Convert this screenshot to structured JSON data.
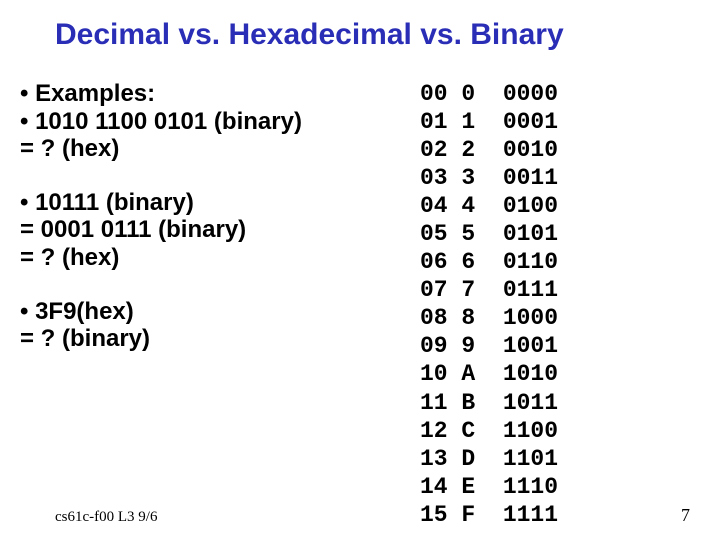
{
  "title": "Decimal vs. Hexadecimal vs. Binary",
  "examples_heading": "• Examples:",
  "ex1_line1": "• 1010 1100 0101 (binary)",
  "ex1_line2": "= ? (hex)",
  "ex2_line1": "• 10111 (binary)",
  "ex2_line2": "= 0001 0111 (binary)",
  "ex2_line3": "= ? (hex)",
  "ex3_line1": "• 3F9(hex)",
  "ex3_line2": "= ? (binary)",
  "footer_left": "cs61c-f00 L3 9/6",
  "footer_right": "7",
  "chart_data": {
    "type": "table",
    "title": "Decimal / Hex / Binary conversion table",
    "columns": [
      "decimal",
      "hex",
      "binary"
    ],
    "rows": [
      {
        "decimal": "00",
        "hex": "0",
        "binary": "0000"
      },
      {
        "decimal": "01",
        "hex": "1",
        "binary": "0001"
      },
      {
        "decimal": "02",
        "hex": "2",
        "binary": "0010"
      },
      {
        "decimal": "03",
        "hex": "3",
        "binary": "0011"
      },
      {
        "decimal": "04",
        "hex": "4",
        "binary": "0100"
      },
      {
        "decimal": "05",
        "hex": "5",
        "binary": "0101"
      },
      {
        "decimal": "06",
        "hex": "6",
        "binary": "0110"
      },
      {
        "decimal": "07",
        "hex": "7",
        "binary": "0111"
      },
      {
        "decimal": "08",
        "hex": "8",
        "binary": "1000"
      },
      {
        "decimal": "09",
        "hex": "9",
        "binary": "1001"
      },
      {
        "decimal": "10",
        "hex": "A",
        "binary": "1010"
      },
      {
        "decimal": "11",
        "hex": "B",
        "binary": "1011"
      },
      {
        "decimal": "12",
        "hex": "C",
        "binary": "1100"
      },
      {
        "decimal": "13",
        "hex": "D",
        "binary": "1101"
      },
      {
        "decimal": "14",
        "hex": "E",
        "binary": "1110"
      },
      {
        "decimal": "15",
        "hex": "F",
        "binary": "1111"
      }
    ]
  }
}
